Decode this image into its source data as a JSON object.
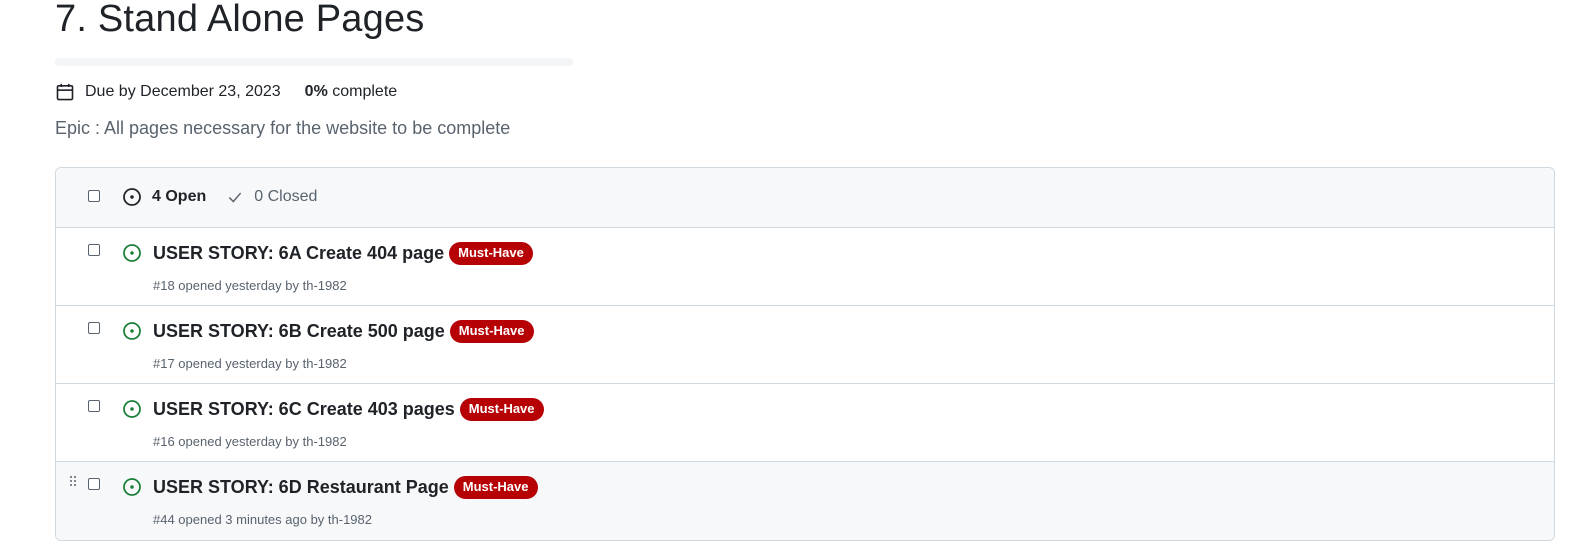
{
  "milestone": {
    "title": "7. Stand Alone Pages",
    "progress_fraction": 0,
    "due_label": "Due by December 23, 2023",
    "percent": "0%",
    "percent_suffix": " complete",
    "description": "Epic : All pages necessary for the website to be complete"
  },
  "issues_header": {
    "open_label": "4 Open",
    "closed_label": "0 Closed"
  },
  "issues": [
    {
      "title": "USER STORY: 6A Create 404 page",
      "label": "Must-Have",
      "meta": "#18 opened yesterday by th-1982"
    },
    {
      "title": "USER STORY: 6B Create 500 page",
      "label": "Must-Have",
      "meta": "#17 opened yesterday by th-1982"
    },
    {
      "title": "USER STORY: 6C Create 403 pages",
      "label": "Must-Have",
      "meta": "#16 opened yesterday by th-1982"
    },
    {
      "title": "USER STORY: 6D Restaurant Page",
      "label": "Must-Have",
      "meta": "#44 opened 3 minutes ago by th-1982"
    }
  ],
  "colors": {
    "open_icon": "#1a7f37",
    "label_bg": "#b60205"
  },
  "icons": {
    "due": "calendar-icon",
    "open": "issue-opened-icon",
    "closed": "check-icon",
    "drag": "grabber-icon"
  }
}
